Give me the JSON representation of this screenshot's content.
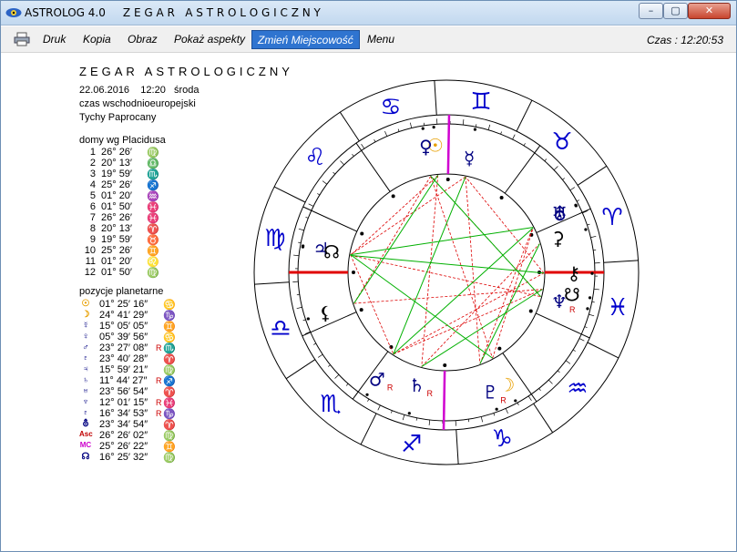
{
  "window": {
    "title": "ASTROLOG 4.0     Z E G A R   A S T R O L O G I C Z N Y",
    "min_label": "–",
    "max_label": "▢",
    "close_label": "✕"
  },
  "menu": {
    "druk": "Druk",
    "kopia": "Kopia",
    "obraz": "Obraz",
    "aspekty": "Pokaż aspekty",
    "miejsce": "Zmień Miejscowość",
    "menu": "Menu",
    "clock": "Czas : 12:20:53"
  },
  "info": {
    "heading": "ZEGAR ASTROLOGICZNY",
    "date": "22.06.2016    12:20   środa",
    "timezone": "czas wschodnioeuropejski",
    "place": "Tychy Paprocany",
    "houses_title": "domy wg Placidusa",
    "planets_title": "pozycje planetarne"
  },
  "houses": [
    {
      "n": "1",
      "pos": "26° 26′",
      "sign": "♍"
    },
    {
      "n": "2",
      "pos": "20° 13′",
      "sign": "♎"
    },
    {
      "n": "3",
      "pos": "19° 59′",
      "sign": "♏"
    },
    {
      "n": "4",
      "pos": "25° 26′",
      "sign": "♐"
    },
    {
      "n": "5",
      "pos": "01° 20′",
      "sign": "♒"
    },
    {
      "n": "6",
      "pos": "01° 50′",
      "sign": "♓"
    },
    {
      "n": "7",
      "pos": "26° 26′",
      "sign": "♓"
    },
    {
      "n": "8",
      "pos": "20° 13′",
      "sign": "♈"
    },
    {
      "n": "9",
      "pos": "19° 59′",
      "sign": "♉"
    },
    {
      "n": "10",
      "pos": "25° 26′",
      "sign": "♊"
    },
    {
      "n": "11",
      "pos": "01° 20′",
      "sign": "♌"
    },
    {
      "n": "12",
      "pos": "01° 50′",
      "sign": "♍"
    }
  ],
  "planets": [
    {
      "sym": "☉",
      "color": "#e8a000",
      "pos": "01° 25′ 16″",
      "r": "",
      "sign": "♋"
    },
    {
      "sym": "☽",
      "color": "#e8a000",
      "pos": "24° 41′ 29″",
      "r": "",
      "sign": "♑"
    },
    {
      "sym": "☿",
      "color": "#000080",
      "pos": "15° 05′ 05″",
      "r": "",
      "sign": "♊"
    },
    {
      "sym": "♀",
      "color": "#000080",
      "pos": "05° 39′ 56″",
      "r": "",
      "sign": "♋"
    },
    {
      "sym": "♂",
      "color": "#000080",
      "pos": "23° 27′ 08″",
      "r": "R",
      "sign": "♏"
    },
    {
      "sym": "♇",
      "color": "#000080",
      "pos": "23° 40′ 28″",
      "r": "",
      "sign": "♈"
    },
    {
      "sym": "♃",
      "color": "#000080",
      "pos": "15° 59′ 21″",
      "r": "",
      "sign": "♍"
    },
    {
      "sym": "♄",
      "color": "#000080",
      "pos": "11° 44′ 27″",
      "r": "R",
      "sign": "♐"
    },
    {
      "sym": "♅",
      "color": "#000080",
      "pos": "23° 56′ 54″",
      "r": "",
      "sign": "♈"
    },
    {
      "sym": "♆",
      "color": "#000080",
      "pos": "12° 01′ 15″",
      "r": "R",
      "sign": "♓"
    },
    {
      "sym": "♇",
      "color": "#000080",
      "pos": "16° 34′ 53″",
      "r": "R",
      "sign": "♑"
    },
    {
      "sym": "⛢",
      "color": "#000080",
      "pos": "23° 34′ 54″",
      "r": "",
      "sign": "♈"
    },
    {
      "sym": "Asc",
      "color": "#c00000",
      "pos": "26° 26′ 02″",
      "r": "",
      "sign": "♍"
    },
    {
      "sym": "MC",
      "color": "#cc00cc",
      "pos": "25° 26′ 22″",
      "r": "",
      "sign": "♊"
    },
    {
      "sym": "☊",
      "color": "#000080",
      "pos": "16° 25′ 32″",
      "r": "",
      "sign": "♍"
    }
  ],
  "wheel": {
    "zodiac": [
      "♈",
      "♉",
      "♊",
      "♋",
      "♌",
      "♍",
      "♎",
      "♏",
      "♐",
      "♑",
      "♒",
      "♓"
    ],
    "zodiac_color": "#0000cc",
    "asc_longitude": 176.43,
    "mc_longitude": 85.44,
    "cusps": [
      176.43,
      200.22,
      229.98,
      265.44,
      301.33,
      331.83,
      356.43,
      20.22,
      49.98,
      85.44,
      121.33,
      151.83
    ],
    "bodies": [
      {
        "glyph": "☉",
        "lon": 91.4,
        "color": "#e8a000",
        "r": false
      },
      {
        "glyph": "☿",
        "lon": 75.1,
        "color": "#000080",
        "r": false
      },
      {
        "glyph": "♀",
        "lon": 95.7,
        "color": "#000080",
        "r": false
      },
      {
        "glyph": "♃",
        "lon": 166.0,
        "color": "#000080",
        "r": false
      },
      {
        "glyph": "☊",
        "lon": 166.4,
        "color": "#000000",
        "r": false
      },
      {
        "glyph": "⚸",
        "lon": 195.0,
        "color": "#000000",
        "r": false
      },
      {
        "glyph": "♂",
        "lon": 233.5,
        "color": "#000080",
        "r": true
      },
      {
        "glyph": "♄",
        "lon": 251.7,
        "color": "#000080",
        "r": true
      },
      {
        "glyph": "♇",
        "lon": 286.6,
        "color": "#000080",
        "r": true
      },
      {
        "glyph": "☽",
        "lon": 294.7,
        "color": "#e8a000",
        "r": false
      },
      {
        "glyph": "♆",
        "lon": 342.0,
        "color": "#000080",
        "r": true
      },
      {
        "glyph": "☋",
        "lon": 346.4,
        "color": "#000000",
        "r": false
      },
      {
        "glyph": "⚷",
        "lon": 356.0,
        "color": "#000000",
        "r": false
      },
      {
        "glyph": "⚳",
        "lon": 13.5,
        "color": "#000000",
        "r": false
      },
      {
        "glyph": "♅",
        "lon": 23.9,
        "color": "#000080",
        "r": false
      },
      {
        "glyph": "⛢",
        "lon": 23.6,
        "color": "#000080",
        "r": false
      }
    ],
    "aspects_red": [
      [
        0,
        4
      ],
      [
        0,
        7
      ],
      [
        1,
        3
      ],
      [
        1,
        8
      ],
      [
        2,
        5
      ],
      [
        2,
        9
      ],
      [
        3,
        6
      ],
      [
        4,
        10
      ],
      [
        5,
        11
      ],
      [
        6,
        12
      ],
      [
        7,
        13
      ],
      [
        8,
        14
      ],
      [
        9,
        15
      ],
      [
        10,
        2
      ],
      [
        11,
        6
      ],
      [
        12,
        1
      ]
    ],
    "aspects_green": [
      [
        0,
        5
      ],
      [
        1,
        6
      ],
      [
        2,
        10
      ],
      [
        3,
        9
      ],
      [
        4,
        12
      ],
      [
        7,
        11
      ],
      [
        8,
        13
      ],
      [
        14,
        3
      ],
      [
        15,
        6
      ]
    ]
  }
}
